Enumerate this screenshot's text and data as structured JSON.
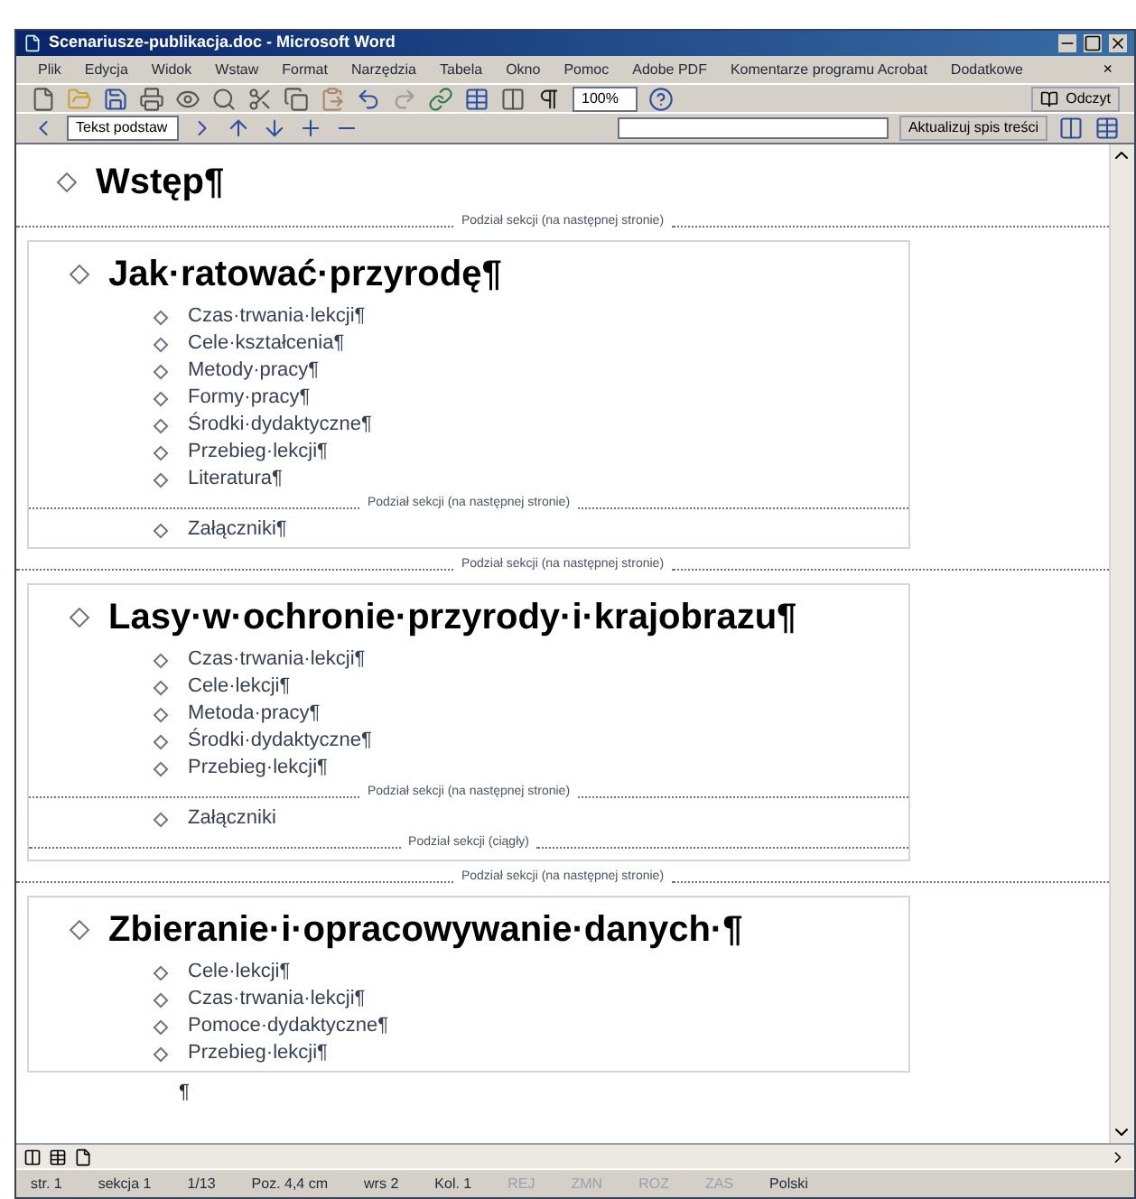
{
  "window": {
    "title": "Scenariusze-publikacja.doc - Microsoft Word"
  },
  "menu": [
    "Plik",
    "Edycja",
    "Widok",
    "Wstaw",
    "Format",
    "Narzędzia",
    "Tabela",
    "Okno",
    "Pomoc",
    "Adobe PDF",
    "Komentarze programu Acrobat",
    "Dodatkowe"
  ],
  "menu_close": "×",
  "toolbar": {
    "zoom": "100%",
    "read_button": "Odczyt"
  },
  "outline_toolbar": {
    "style": "Tekst podstaw",
    "update_toc": "Aktualizuj spis treści"
  },
  "document": [
    {
      "kind": "plain",
      "blocks": [
        {
          "kind": "heading",
          "text": "Wstęp¶"
        },
        {
          "kind": "break",
          "text": "Podział sekcji (na następnej stronie)"
        }
      ]
    },
    {
      "kind": "framed",
      "blocks": [
        {
          "kind": "heading",
          "text": "Jak·ratować·przyrodę¶"
        },
        {
          "kind": "item",
          "text": "Czas·trwania·lekcji¶"
        },
        {
          "kind": "item",
          "text": "Cele·kształcenia¶"
        },
        {
          "kind": "item",
          "text": "Metody·pracy¶"
        },
        {
          "kind": "item",
          "text": "Formy·pracy¶"
        },
        {
          "kind": "item",
          "text": "Środki·dydaktyczne¶"
        },
        {
          "kind": "item",
          "text": "Przebieg·lekcji¶"
        },
        {
          "kind": "item",
          "text": "Literatura¶"
        },
        {
          "kind": "break",
          "text": "Podział sekcji (na następnej stronie)"
        },
        {
          "kind": "item",
          "text": "Załączniki¶"
        }
      ]
    },
    {
      "kind": "plain",
      "blocks": [
        {
          "kind": "break",
          "text": "Podział sekcji (na następnej stronie)"
        }
      ]
    },
    {
      "kind": "framed",
      "blocks": [
        {
          "kind": "heading",
          "text": "Lasy·w·ochronie·przyrody·i·krajobrazu¶"
        },
        {
          "kind": "item",
          "text": "Czas·trwania·lekcji¶"
        },
        {
          "kind": "item",
          "text": "Cele·lekcji¶"
        },
        {
          "kind": "item",
          "text": "Metoda·pracy¶"
        },
        {
          "kind": "item",
          "text": "Środki·dydaktyczne¶"
        },
        {
          "kind": "item",
          "text": "Przebieg·lekcji¶"
        },
        {
          "kind": "break",
          "text": "Podział sekcji (na następnej stronie)"
        },
        {
          "kind": "item",
          "text": "Załączniki"
        },
        {
          "kind": "break",
          "text": "Podział sekcji (ciągły)"
        }
      ]
    },
    {
      "kind": "plain",
      "blocks": [
        {
          "kind": "break",
          "text": "Podział sekcji (na następnej stronie)"
        }
      ]
    },
    {
      "kind": "framed",
      "blocks": [
        {
          "kind": "heading",
          "text": "Zbieranie·i·opracowywanie·danych·¶"
        },
        {
          "kind": "item",
          "text": "Cele·lekcji¶"
        },
        {
          "kind": "item",
          "text": "Czas·trwania·lekcji¶"
        },
        {
          "kind": "item",
          "text": "Pomoce·dydaktyczne¶"
        },
        {
          "kind": "item",
          "text": "Przebieg·lekcji¶"
        }
      ]
    },
    {
      "kind": "plain",
      "blocks": [
        {
          "kind": "empty",
          "text": "¶"
        }
      ]
    }
  ],
  "status_bar": [
    {
      "text": "str. 1",
      "disabled": false
    },
    {
      "text": "sekcja 1",
      "disabled": false
    },
    {
      "text": "1/13",
      "disabled": false
    },
    {
      "text": "Poz. 4,4 cm",
      "disabled": false
    },
    {
      "text": "wrs 2",
      "disabled": false
    },
    {
      "text": "Kol. 1",
      "disabled": false
    },
    {
      "text": "REJ",
      "disabled": true
    },
    {
      "text": "ZMN",
      "disabled": true
    },
    {
      "text": "ROZ",
      "disabled": true
    },
    {
      "text": "ZAS",
      "disabled": true
    },
    {
      "text": "Polski",
      "disabled": false
    }
  ]
}
